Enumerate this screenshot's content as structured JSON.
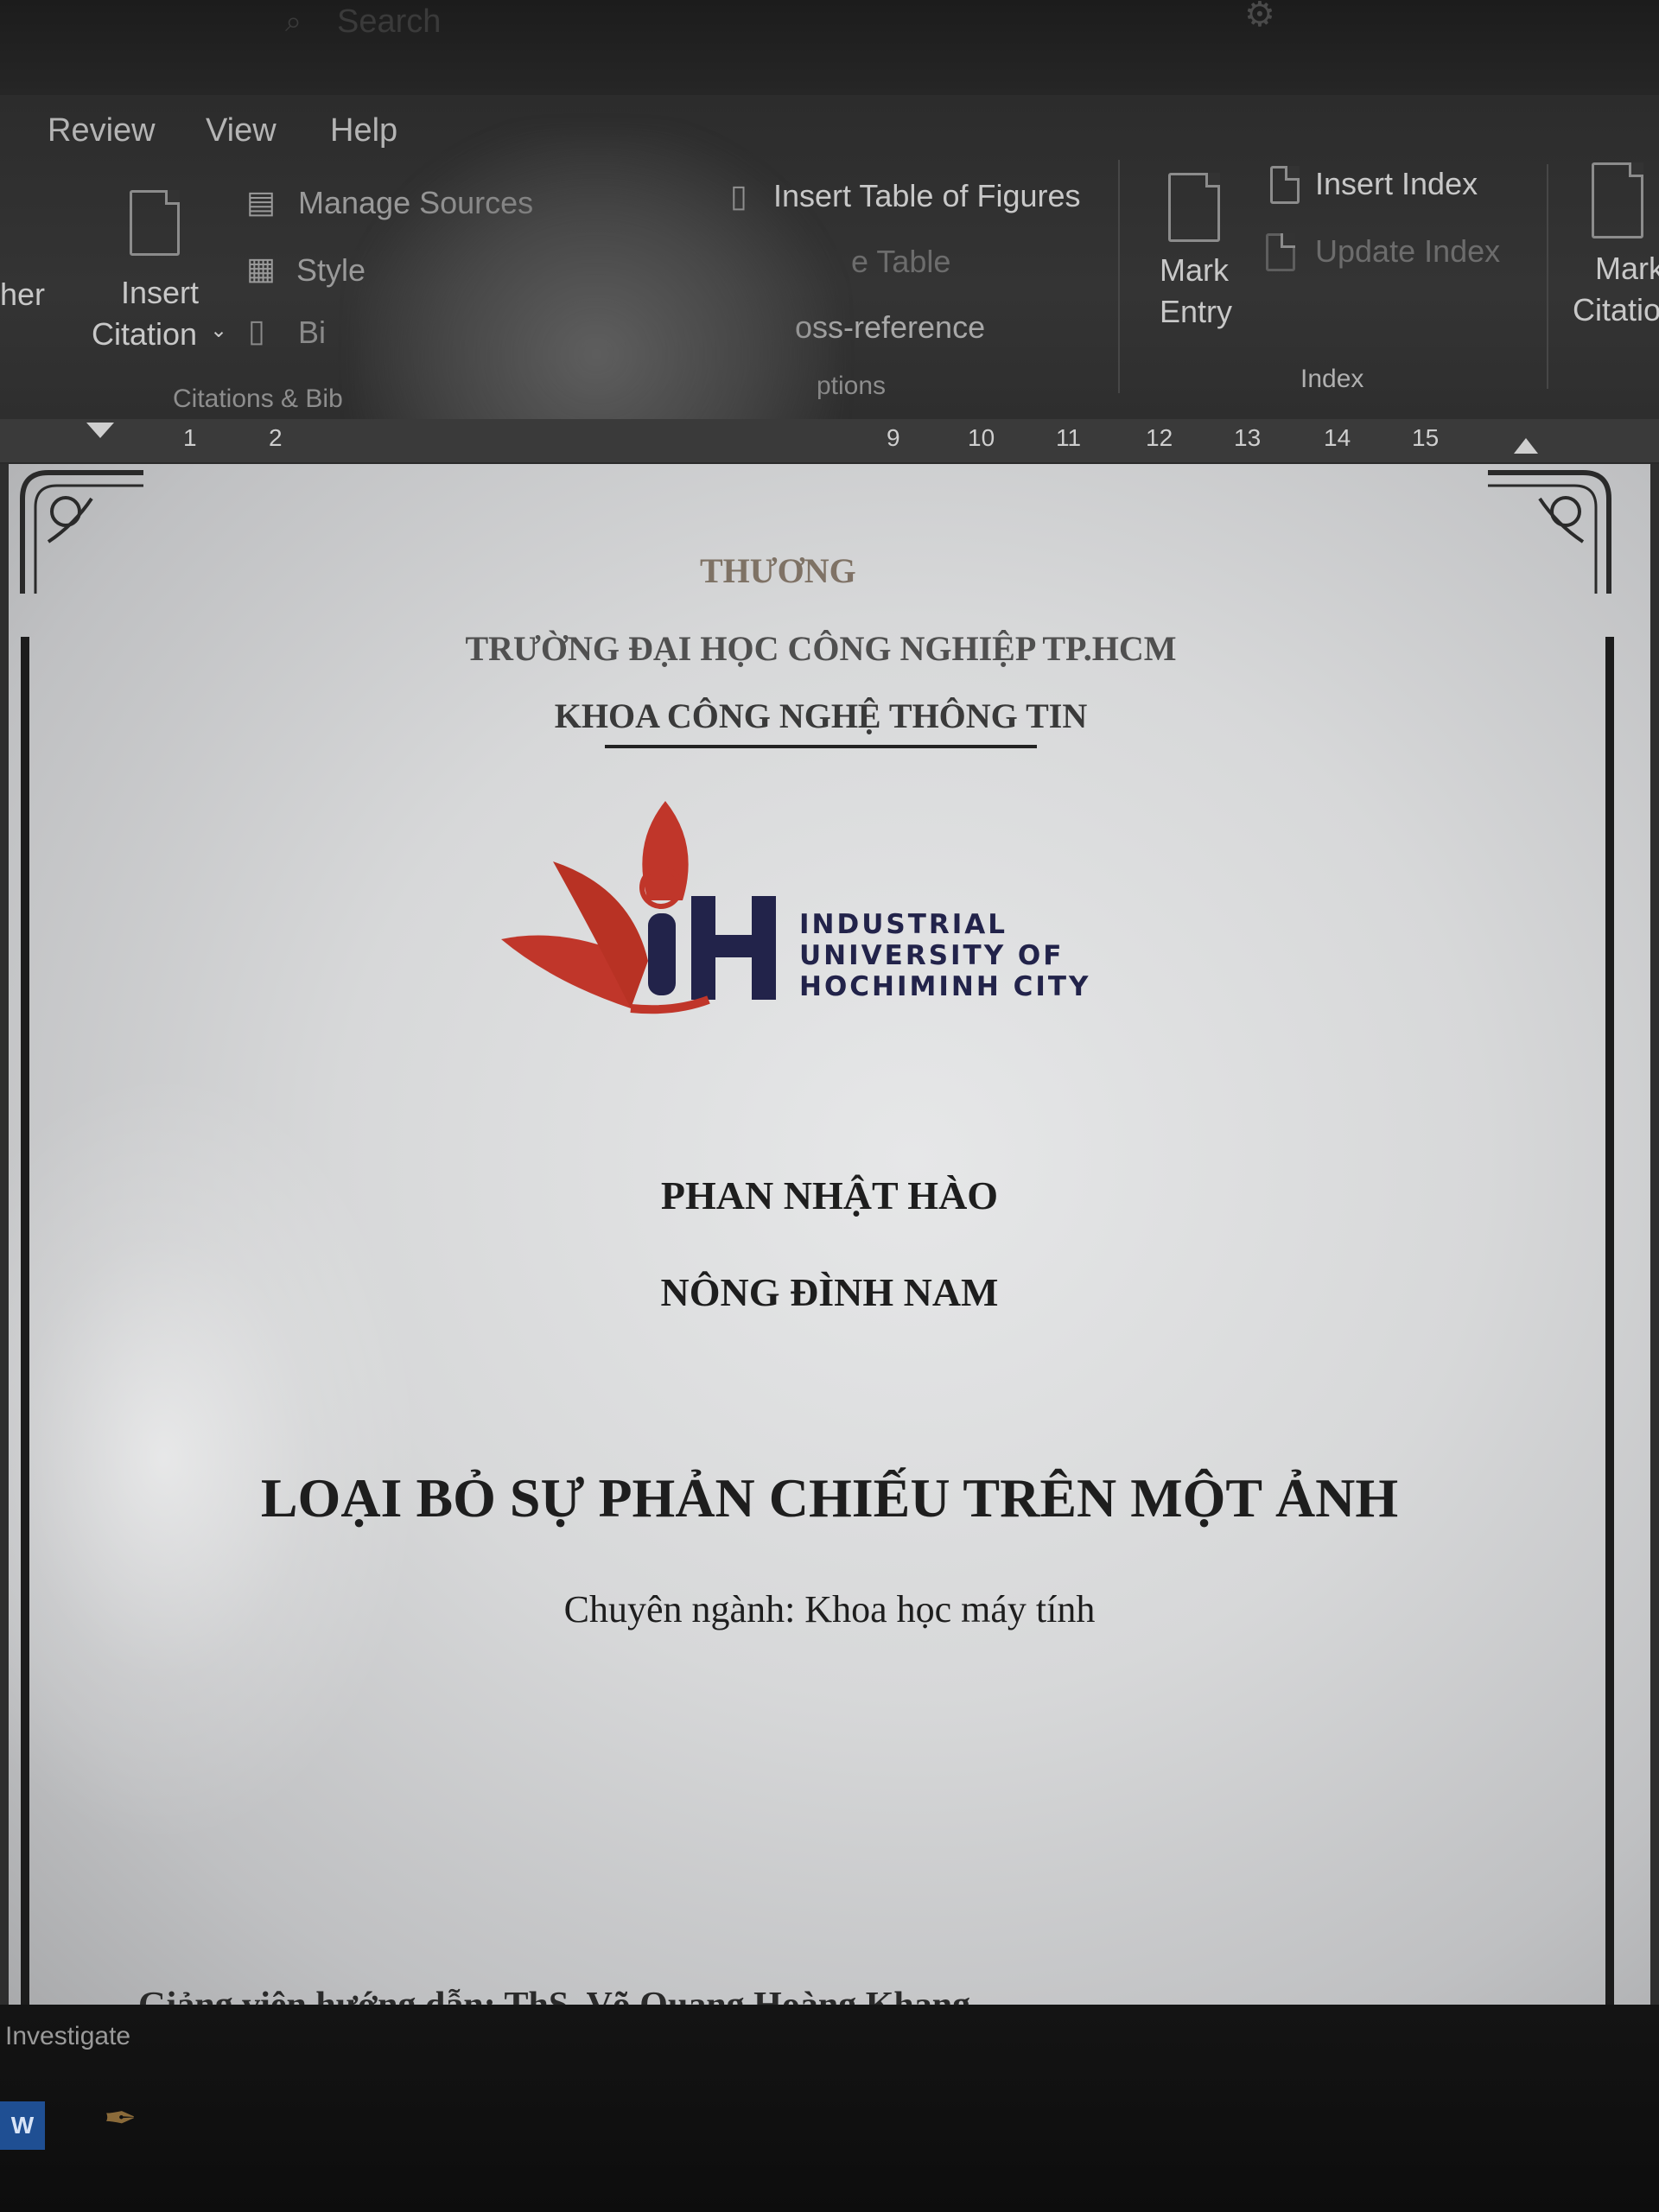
{
  "titlebar": {
    "search_placeholder": "Search"
  },
  "ribbon": {
    "tabs": [
      "Review",
      "View",
      "Help"
    ],
    "citations": {
      "left_cut_label": "her",
      "insert_citation_line1": "Insert",
      "insert_citation_line2": "Citation",
      "manage_sources": "Manage Sources",
      "style": "Style",
      "bibliography": "Bi",
      "group_label": "Citations & Bib"
    },
    "captions": {
      "insert_table_of_figures": "Insert Table of Figures",
      "update_table": "e Table",
      "cross_reference": "oss-reference",
      "group_label": "ptions"
    },
    "index": {
      "mark_entry_line1": "Mark",
      "mark_entry_line2": "Entry",
      "insert_index": "Insert Index",
      "update_index": "Update Index",
      "group_label": "Index"
    },
    "table_of_authorities": {
      "mark_citation_line1": "Mark",
      "mark_citation_line2": "Citatio"
    }
  },
  "ruler": {
    "numbers": [
      "1",
      "2",
      "9",
      "10",
      "11",
      "12",
      "13",
      "14",
      "15"
    ]
  },
  "document": {
    "ministry_line": "THƯƠNG",
    "university_line": "TRƯỜNG ĐẠI HỌC CÔNG NGHIỆP TP.HCM",
    "faculty_line": "KHOA CÔNG NGHỆ THÔNG TIN",
    "logo_text": [
      "INDUSTRIAL",
      "UNIVERSITY OF",
      "HOCHIMINH CITY"
    ],
    "author_1": "PHAN NHẬT HÀO",
    "author_2": "NÔNG ĐÌNH NAM",
    "thesis_title": "LOẠI BỎ SỰ PHẢN CHIẾU TRÊN MỘT ẢNH",
    "major": "Chuyên ngành: Khoa học máy tính",
    "advisor": "Giảng viên hướng dẫn: ThS. Võ Quang Hoàng Khang"
  },
  "taskbar": {
    "investigate": "Investigate",
    "word_icon_letter": "W"
  },
  "colors": {
    "logo_red": "#c0362a",
    "logo_navy": "#22234a"
  }
}
